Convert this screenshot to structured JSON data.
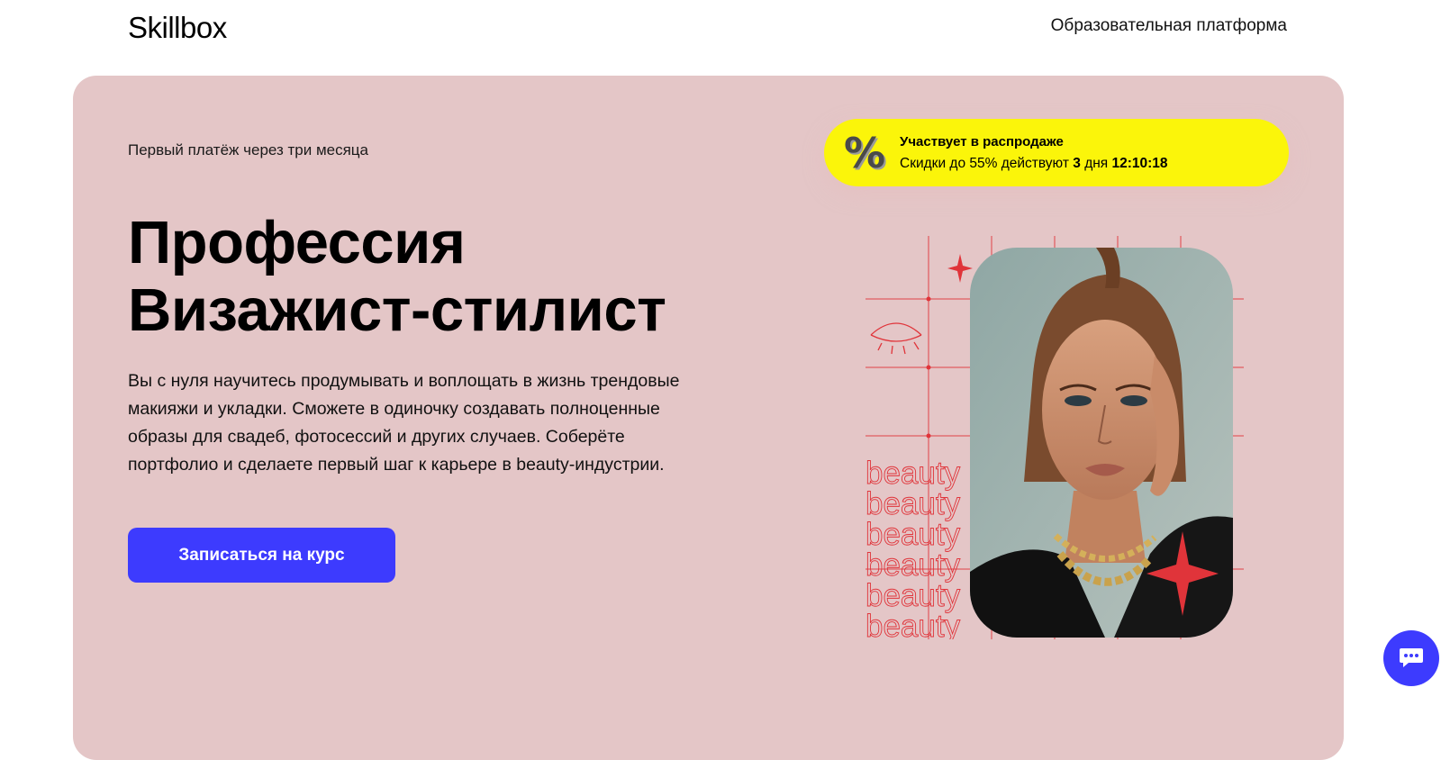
{
  "header": {
    "logo": "Skillbox",
    "platform_link": "Образовательная платформа"
  },
  "hero": {
    "subtitle": "Первый платёж через три месяца",
    "title_line1": "Профессия",
    "title_line2": "Визажист-стилист",
    "description": "Вы с нуля научитесь продумывать и воплощать в жизнь трендовые макияжи и укладки. Сможете в одиночку создавать полноценные образы для свадеб, фотосессий и других случаев. Соберёте портфолио и сделаете первый шаг к карьере в beauty-индустрии.",
    "cta_label": "Записаться на курс"
  },
  "sale": {
    "icon": "%",
    "title": "Участвует в распродаже",
    "text_prefix": "Скидки до 55% действуют",
    "days": "3",
    "days_unit": "дня",
    "timer": "12:10:18"
  },
  "visual": {
    "word": "beauty"
  },
  "colors": {
    "hero_bg": "#e4c6c7",
    "accent": "#3d3bfe",
    "sale_bg": "#fbf50a",
    "decor_red": "#e0343a"
  },
  "icons": {
    "chat": "chat-bubble-icon",
    "sale": "percent-icon",
    "eye": "eye-icon",
    "sparkle": "sparkle-icon"
  }
}
